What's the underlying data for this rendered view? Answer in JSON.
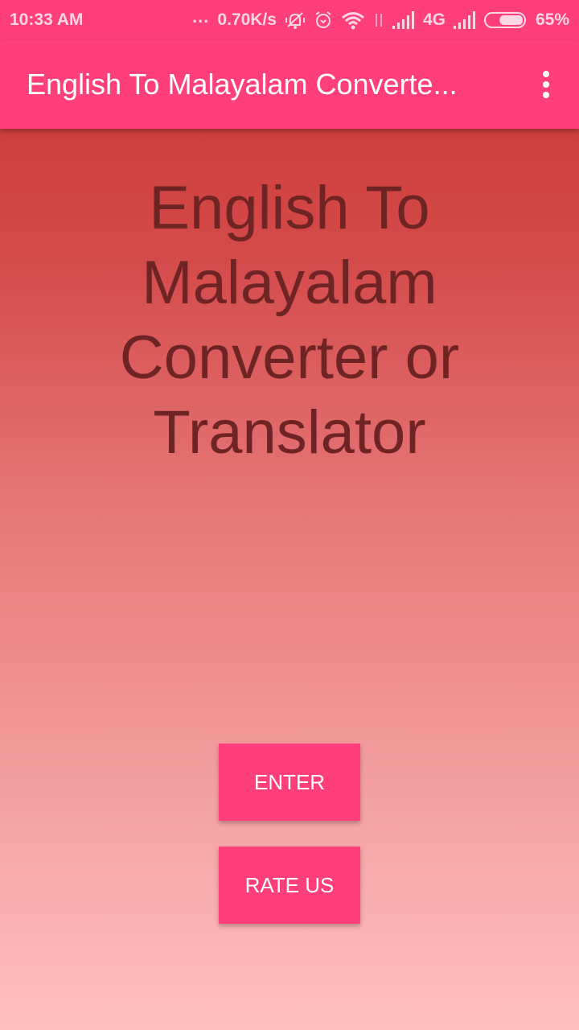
{
  "status_bar": {
    "time": "10:33 AM",
    "more_indicator": "...",
    "network_speed": "0.70K/s",
    "network_type": "4G",
    "battery_percent": "65%",
    "battery_level": 0.65,
    "icons": [
      "mute-notifications-icon",
      "alarm-icon",
      "wifi-icon",
      "data-transfer-icon",
      "signal-icon",
      "signal-icon-2",
      "battery-icon"
    ]
  },
  "app_bar": {
    "title": "English To Malayalam Converte...",
    "overflow_icon": "more-vert-icon"
  },
  "main": {
    "headline": "English To Malayalam Converter or Translator",
    "buttons": {
      "enter": "ENTER",
      "rate_us": "RATE US"
    }
  },
  "colors": {
    "primary": "#ff3f7c",
    "headline_text": "#6e2424",
    "gradient_top": "#cc3333",
    "gradient_bottom": "#ffc0bf"
  }
}
